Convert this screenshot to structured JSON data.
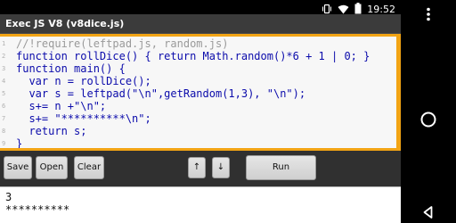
{
  "status_bar": {
    "time": "19:52",
    "icons": [
      "vibrate-icon",
      "wifi-icon",
      "battery-icon"
    ]
  },
  "app_title": "Exec JS V8 (v8dice.js)",
  "editor": {
    "lines": [
      {
        "num": "1",
        "text": "//!require(leftpad.js, random.js)"
      },
      {
        "num": "2",
        "text": "function rollDice() { return Math.random()*6 + 1 | 0; }"
      },
      {
        "num": "3",
        "text": "function main() {"
      },
      {
        "num": "4",
        "text": "  var n = rollDice();"
      },
      {
        "num": "5",
        "text": "  var s = leftpad(\"\\n\",getRandom(1,3), \"\\n\");"
      },
      {
        "num": "6",
        "text": "  s+= n +\"\\n\";"
      },
      {
        "num": "7",
        "text": "  s+= \"**********\\n\";"
      },
      {
        "num": "8",
        "text": "  return s;"
      },
      {
        "num": "9",
        "text": "}"
      }
    ]
  },
  "toolbar": {
    "save_label": "Save",
    "open_label": "Open",
    "clear_label": "Clear",
    "up_label": "↑",
    "down_label": "↓",
    "run_label": "Run"
  },
  "output": {
    "lines": [
      "3",
      "**********"
    ]
  },
  "nav": [
    "menu-icon",
    "home-icon",
    "back-icon"
  ],
  "colors": {
    "editor_border": "#f2a414",
    "code_text": "#0b0bab",
    "comment_text": "#9a9a9a",
    "string_text": "#1a7a1a"
  }
}
